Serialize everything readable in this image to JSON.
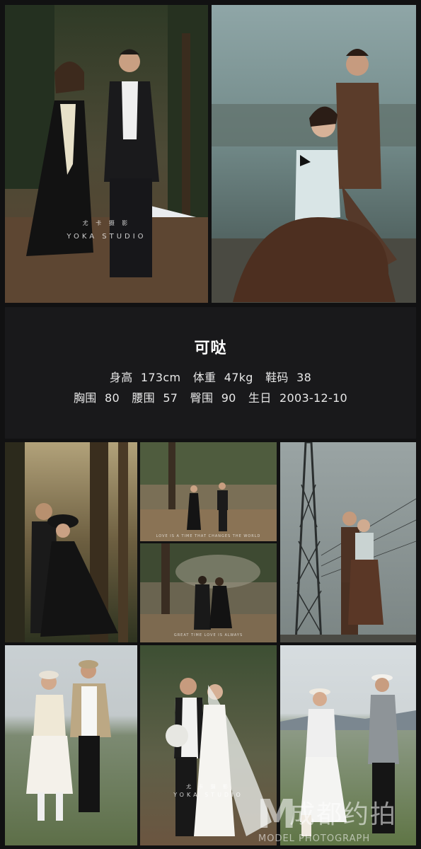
{
  "model": {
    "name": "可哒",
    "stats_line1": [
      {
        "label": "身高",
        "value": "173cm"
      },
      {
        "label": "体重",
        "value": "47kg"
      },
      {
        "label": "鞋码",
        "value": "38"
      }
    ],
    "stats_line2": [
      {
        "label": "胸围",
        "value": "80"
      },
      {
        "label": "腰围",
        "value": "57"
      },
      {
        "label": "臀围",
        "value": "90"
      },
      {
        "label": "生日",
        "value": "2003-12-10"
      }
    ]
  },
  "watermarks": {
    "studio_cn": "尤 卡 摄 影",
    "studio_en": "YOKA STUDIO",
    "small_caption_1": "LOVE IS A TIME THAT CHANGES THE WORLD",
    "small_caption_2": "GREAT TIME LOVE IS ALWAYS",
    "site_logo_m": "M",
    "site_logo_cn": "成都约拍",
    "site_logo_en": "MODEL PHOTOGRAPH"
  },
  "colors": {
    "background": "#111112",
    "panel": "#19191b",
    "name_text": "#ffffff",
    "stats_text": "#e8e8e8"
  }
}
